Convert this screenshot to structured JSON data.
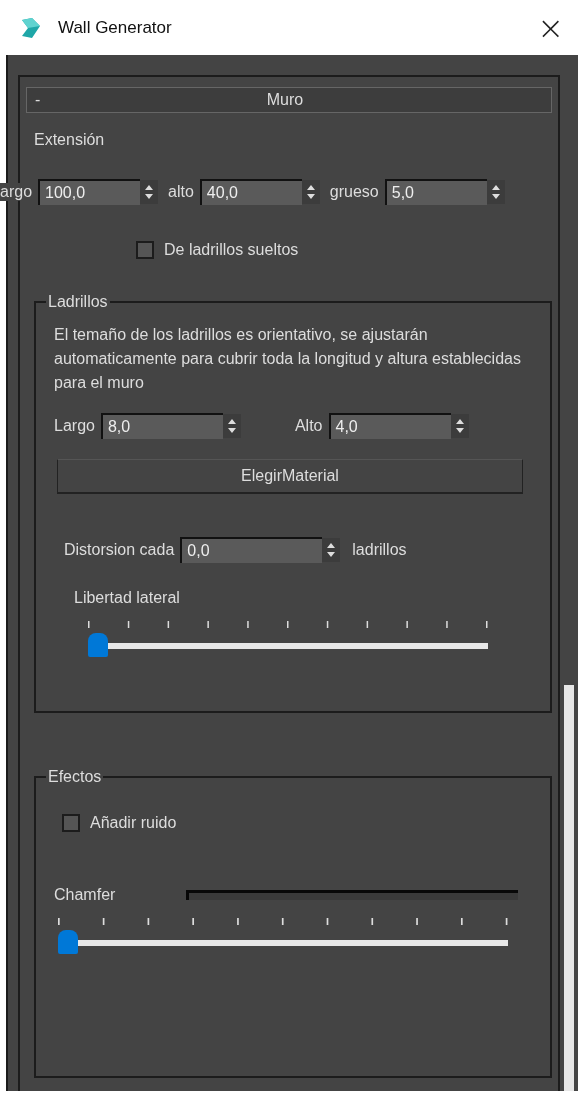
{
  "window": {
    "title": "Wall Generator",
    "close": "×"
  },
  "rollout": {
    "collapse_symbol": "-",
    "title": "Muro"
  },
  "extension": {
    "label": "Extensión",
    "spinners": [
      {
        "label": "argo",
        "value": "100,0"
      },
      {
        "label": "alto",
        "value": "40,0"
      },
      {
        "label": "grueso",
        "value": "5,0"
      }
    ]
  },
  "loose_bricks": {
    "label": "De ladrillos sueltos",
    "checked": false
  },
  "bricks": {
    "title": "Ladrillos",
    "note": "El temaño de los ladrillos es orientativo, se ajustarán automaticamente para cubrir toda la longitud y altura establecidas para el muro",
    "spinners": [
      {
        "label": "Largo",
        "value": "8,0"
      },
      {
        "label": "Alto",
        "value": "4,0"
      }
    ],
    "material_button": "ElegirMaterial",
    "distortion": {
      "label": "Distorsion cada",
      "value": "0,0",
      "unit": "ladrillos"
    },
    "lateral": {
      "label": "Libertad lateral",
      "level": 0
    }
  },
  "effects": {
    "title": "Efectos",
    "noise": {
      "label": "Añadir ruido",
      "checked": false
    },
    "chamfer": {
      "label": "Chamfer",
      "progress": {
        "level": 0
      },
      "slider": {
        "level": 0
      }
    }
  }
}
